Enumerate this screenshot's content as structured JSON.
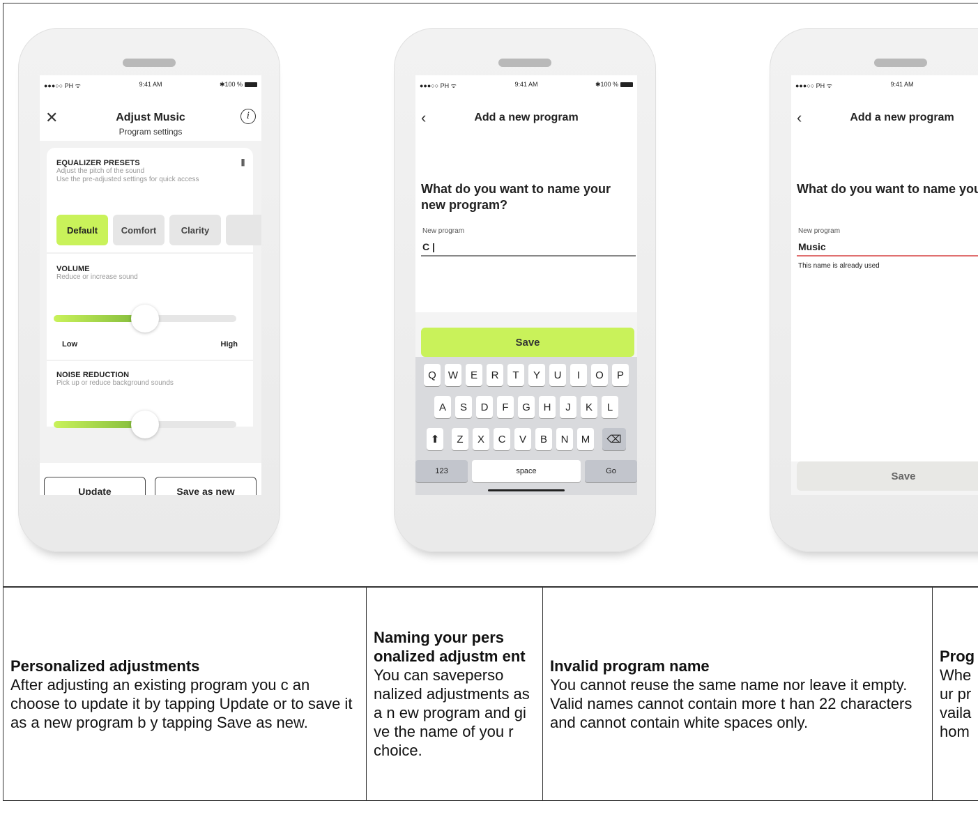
{
  "phones": [
    {
      "status": {
        "carrier": "●●●○○ PH ᯤ",
        "time": "9:41 AM",
        "battery": "✱100 %"
      },
      "nav": {
        "left_icon": "close-icon",
        "title": "Adjust Music",
        "subtitle": "Program settings",
        "right_icon": "info-icon"
      },
      "equalizer": {
        "title": "EQUALIZER PRESETS",
        "desc1": "Adjust the pitch of the sound",
        "desc2": "Use the pre-adjusted settings for quick access",
        "presets": [
          "Default",
          "Comfort",
          "Clarity",
          ""
        ],
        "active": "Default"
      },
      "volume": {
        "title": "VOLUME",
        "desc": "Reduce or increase sound",
        "low": "Low",
        "high": "High",
        "level": 0.5
      },
      "noise": {
        "title": "NOISE REDUCTION",
        "desc": "Pick up or reduce background sounds",
        "level": 0.5
      },
      "buttons": {
        "update": "Update",
        "save_new": "Save as new"
      }
    },
    {
      "status": {
        "carrier": "●●●○○ PH ᯤ",
        "time": "9:41 AM",
        "battery": "✱100 %"
      },
      "nav": {
        "left_icon": "back-icon",
        "title": "Add a new program"
      },
      "question": "What do you want to name your new program?",
      "field_label": "New program",
      "field_value": "C |",
      "save": "Save",
      "keyboard": {
        "row1": [
          "Q",
          "W",
          "E",
          "R",
          "T",
          "Y",
          "U",
          "I",
          "O",
          "P"
        ],
        "row2": [
          "A",
          "S",
          "D",
          "F",
          "G",
          "H",
          "J",
          "K",
          "L"
        ],
        "row3": [
          "Z",
          "X",
          "C",
          "V",
          "B",
          "N",
          "M"
        ],
        "shift": "⬆",
        "backspace": "⌫",
        "numbers": "123",
        "space": "space",
        "go": "Go"
      }
    },
    {
      "status": {
        "carrier": "●●●○○ PH ᯤ",
        "time": "9:41 AM",
        "battery": "✱"
      },
      "nav": {
        "left_icon": "back-icon",
        "title": "Add a new program"
      },
      "question": "What do you want to name your new program?",
      "field_label": "New program",
      "field_value": "Music",
      "error": "This name is already used",
      "save": "Save"
    }
  ],
  "table": [
    {
      "title": "Personalized adjustments",
      "body": "After adjusting an existing program you c an choose to update it by tapping Update or to save it as a new program b y tapping Save as new."
    },
    {
      "title": "Naming your pers onalized adjustm ent",
      "body": "You can saveperso nalized adjustments as a n ew program and gi ve the name of you r choice."
    },
    {
      "title": "Invalid program name",
      "body": "You cannot reuse the same name nor leave it empty. Valid names cannot contain more t han 22 characters and cannot contain white spaces only."
    },
    {
      "title": "Prog",
      "body": "Whe ur pr vaila hom"
    }
  ],
  "colors": {
    "accent": "#c9f25a",
    "error_line": "#e07070"
  }
}
